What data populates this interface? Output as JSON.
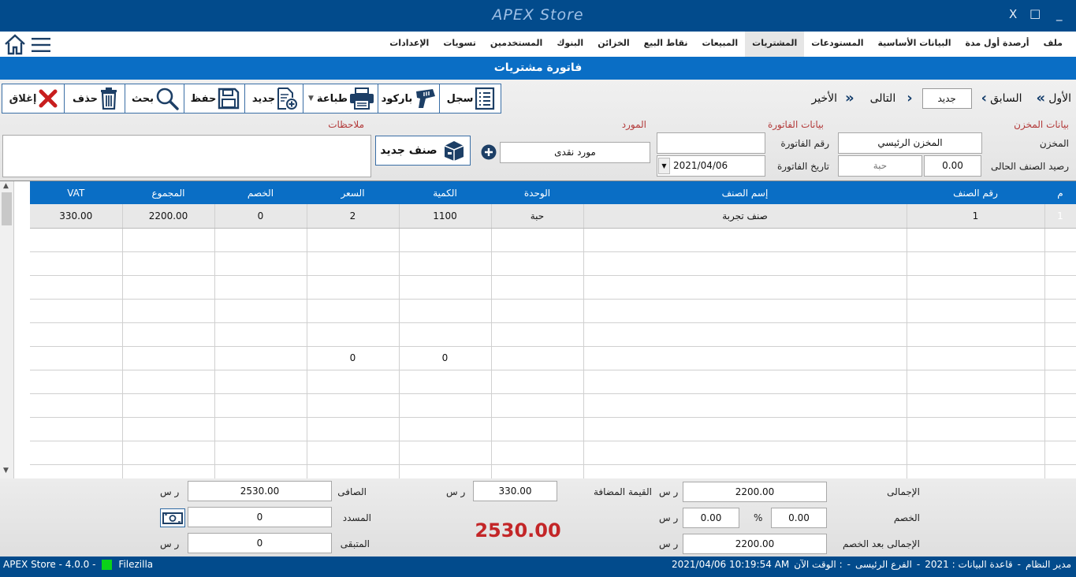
{
  "app": {
    "title": "APEX Store"
  },
  "window": {
    "close": "X",
    "maximize": "□",
    "minimize": "_"
  },
  "menu": {
    "tabs": [
      {
        "label": "ملف",
        "active": false
      },
      {
        "label": "أرصدة أول مدة",
        "active": false
      },
      {
        "label": "البيانات الأساسية",
        "active": false
      },
      {
        "label": "المستودعات",
        "active": false
      },
      {
        "label": "المشتريات",
        "active": true
      },
      {
        "label": "المبيعات",
        "active": false
      },
      {
        "label": "نقاط البيع",
        "active": false
      },
      {
        "label": "الخزائن",
        "active": false
      },
      {
        "label": "البنوك",
        "active": false
      },
      {
        "label": "المستخدمين",
        "active": false
      },
      {
        "label": "تسويات",
        "active": false
      },
      {
        "label": "الإعدادات",
        "active": false
      }
    ]
  },
  "form": {
    "title": "فاتورة مشتريات"
  },
  "toolbar": {
    "close": "إغلاق",
    "delete": "حذف",
    "search": "بحث",
    "save": "حفظ",
    "new": "جديد",
    "print": "طباعة",
    "barcode": "باركود",
    "log": "سجل"
  },
  "nav": {
    "first": "الأول",
    "prev": "السابق",
    "current": "جديد",
    "next": "التالى",
    "last": "الأخير"
  },
  "store": {
    "section_title": "بيانات المخزن",
    "store_label": "المخزن",
    "store_value": "المخزن الرئيسي",
    "balance_label": "رصيد الصنف الحالى",
    "balance_value": "0.00",
    "balance_unit": "حبة"
  },
  "invoice": {
    "section_title": "بيانات الفاتورة",
    "number_label": "رقم الفاتورة",
    "number_value": "",
    "date_label": "تاريخ الفاتورة",
    "date_value": "2021/04/06"
  },
  "supplier": {
    "section_title": "المورد",
    "value": "مورد نقدى",
    "new_item_label": "صنف جديد"
  },
  "notes": {
    "section_title": "ملاحظات",
    "value": ""
  },
  "grid": {
    "columns": [
      "VAT",
      "المجموع",
      "الخصم",
      "السعر",
      "الكمية",
      "الوحدة",
      "إسم الصنف",
      "رقم الصنف",
      "م"
    ],
    "rows": [
      [
        "330.00",
        "2200.00",
        "0",
        "2",
        "1100",
        "حبة",
        "صنف تجربة",
        "1",
        "1"
      ],
      [
        "",
        "",
        "",
        "",
        "",
        "",
        "",
        "",
        ""
      ],
      [
        "",
        "",
        "",
        "",
        "",
        "",
        "",
        "",
        ""
      ],
      [
        "",
        "",
        "",
        "",
        "",
        "",
        "",
        "",
        ""
      ],
      [
        "",
        "",
        "",
        "",
        "",
        "",
        "",
        "",
        ""
      ],
      [
        "",
        "",
        "",
        "",
        "",
        "",
        "",
        "",
        ""
      ],
      [
        "",
        "",
        "",
        "0",
        "0",
        "",
        "",
        "",
        ""
      ],
      [
        "",
        "",
        "",
        "",
        "",
        "",
        "",
        "",
        ""
      ],
      [
        "",
        "",
        "",
        "",
        "",
        "",
        "",
        "",
        ""
      ],
      [
        "",
        "",
        "",
        "",
        "",
        "",
        "",
        "",
        ""
      ],
      [
        "",
        "",
        "",
        "",
        "",
        "",
        "",
        "",
        ""
      ],
      [
        "",
        "",
        "",
        "",
        "",
        "",
        "",
        "",
        ""
      ]
    ]
  },
  "totals": {
    "total_label": "الإجمالى",
    "total_value": "2200.00",
    "discount_label": "الخصم",
    "discount_value": "0.00",
    "discount_percent_sign": "%",
    "discount_percent_value": "0.00",
    "after_discount_label": "الإجمالى بعد الخصم",
    "after_discount_value": "2200.00",
    "vat_label": "القيمة المضافة",
    "vat_value": "330.00",
    "net_label": "الصافى",
    "net_value": "2530.00",
    "paid_label": "المسدد",
    "paid_value": "0",
    "remaining_label": "المتبقى",
    "remaining_value": "0",
    "currency": "ر س",
    "grand_total": "2530.00"
  },
  "status": {
    "left_version": "APEX Store - 4.0.0  -",
    "left_app": "Filezilla",
    "user": "مدير النظام",
    "database": "قاعدة البيانات : 2021",
    "branch": "الفرع الرئيسى",
    "time_label": "الوقت الآن :",
    "time_value": "2021/04/06 10:19:54 AM"
  },
  "colors": {
    "titlebar": "#024b8c",
    "accent": "#0a6ec5",
    "grand_total": "#c32628",
    "section_title": "#b33a3a"
  },
  "icons": [
    "home-icon",
    "hamburger-icon",
    "close-x-icon",
    "trash-icon",
    "magnifier-icon",
    "floppy-icon",
    "new-doc-icon",
    "printer-icon",
    "barcode-scanner-icon",
    "log-list-icon",
    "chevron-icon",
    "box-icon",
    "plus-circle-icon",
    "cash-icon"
  ]
}
